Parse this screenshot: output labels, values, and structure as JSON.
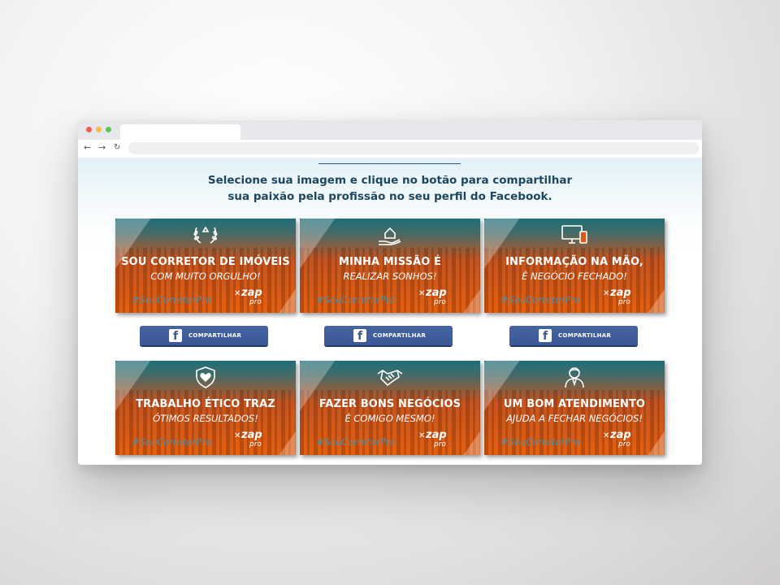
{
  "browser": {
    "back_icon": "arrow-left-icon",
    "forward_icon": "arrow-right-icon",
    "reload_icon": "reload-icon"
  },
  "headline": {
    "line1": "Selecione sua imagem e clique no botão para compartilhar",
    "line2": "sua paixão pela profissão no seu perfil do Facebook."
  },
  "cards": [
    {
      "icon": "laurel-wreath-icon",
      "title": "SOU CORRETOR DE IMÓVEIS",
      "subtitle": "COM MUITO ORGULHO!",
      "hashtag": "#SouCorretorPro",
      "brand": "zap",
      "brand_sub": "pro"
    },
    {
      "icon": "house-in-hand-icon",
      "title": "MINHA MISSÃO É",
      "subtitle": "REALIZAR SONHOS!",
      "hashtag": "#SouCorretorPro",
      "brand": "zap",
      "brand_sub": "pro"
    },
    {
      "icon": "devices-icon",
      "title": "INFORMAÇÃO NA MÃO,",
      "subtitle": "É NEGÓCIO FECHADO!",
      "hashtag": "#SouCorretorPro",
      "brand": "zap",
      "brand_sub": "pro"
    },
    {
      "icon": "shield-heart-icon",
      "title": "TRABALHO ÉTICO TRAZ",
      "subtitle": "ÓTIMOS RESULTADOS!",
      "hashtag": "#SouCorretorPro",
      "brand": "zap",
      "brand_sub": "pro"
    },
    {
      "icon": "handshake-icon",
      "title": "FAZER BONS NEGÓCIOS",
      "subtitle": "É COMIGO MESMO!",
      "hashtag": "#SouCorretorPro",
      "brand": "zap",
      "brand_sub": "pro"
    },
    {
      "icon": "person-icon",
      "title": "UM BOM ATENDIMENTO",
      "subtitle": "AJUDA A FECHAR NEGÓCIOS!",
      "hashtag": "#SouCorretorPro",
      "brand": "zap",
      "brand_sub": "pro"
    }
  ],
  "share_buttons": [
    {
      "label": "COMPARTILHAR",
      "icon": "facebook-icon"
    },
    {
      "label": "COMPARTILHAR",
      "icon": "facebook-icon"
    },
    {
      "label": "COMPARTILHAR",
      "icon": "facebook-icon"
    }
  ],
  "colors": {
    "heading": "#1d4660",
    "card_orange": "#e4600f",
    "card_teal": "#1f6f79",
    "facebook_blue": "#3b5998",
    "hashtag": "#4e8ea6"
  }
}
